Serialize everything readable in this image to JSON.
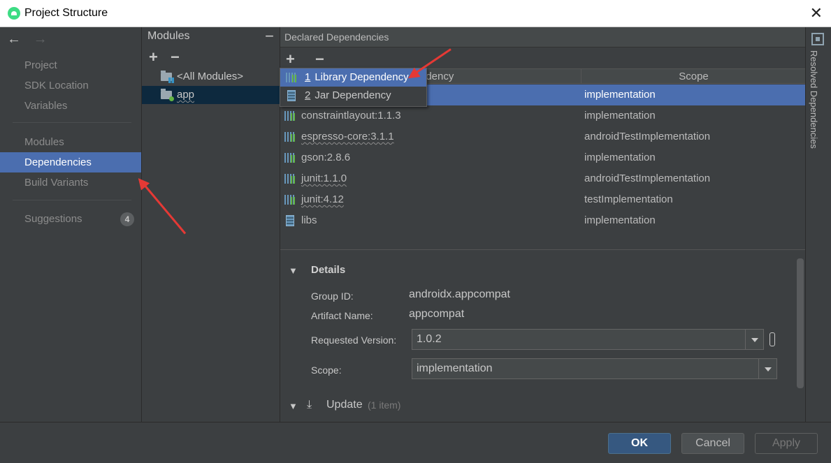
{
  "window": {
    "title": "Project Structure"
  },
  "nav": {
    "back_icon": "arrow-left-icon",
    "forward_icon": "arrow-right-icon",
    "items": [
      {
        "label": "Project"
      },
      {
        "label": "SDK Location"
      },
      {
        "label": "Variables"
      },
      {
        "label": "Modules"
      },
      {
        "label": "Dependencies",
        "selected": true
      },
      {
        "label": "Build Variants"
      },
      {
        "label": "Suggestions",
        "badge": "4"
      }
    ]
  },
  "modules": {
    "header": "Modules",
    "add": "+",
    "remove": "−",
    "collapse": "−",
    "items": [
      {
        "label": "<All Modules>"
      },
      {
        "label": "app",
        "selected": true
      }
    ]
  },
  "dependencies": {
    "header": "Declared Dependencies",
    "add": "+",
    "remove": "−",
    "columns": {
      "dependency": "ndency",
      "scope": "Scope"
    },
    "rows": [
      {
        "name": "",
        "scope": "implementation",
        "icon": "library-icon",
        "selected": true
      },
      {
        "name": "constraintlayout:1.1.3",
        "scope": "implementation",
        "icon": "library-icon"
      },
      {
        "name": "espresso-core:3.1.1",
        "scope": "androidTestImplementation",
        "icon": "library-icon"
      },
      {
        "name": "gson:2.8.6",
        "scope": "implementation",
        "icon": "library-icon"
      },
      {
        "name": "junit:1.1.0",
        "scope": "androidTestImplementation",
        "icon": "library-icon"
      },
      {
        "name": "junit:4.12",
        "scope": "testImplementation",
        "icon": "library-icon"
      },
      {
        "name": "libs",
        "scope": "implementation",
        "icon": "jar-icon"
      }
    ]
  },
  "popup": {
    "items": [
      {
        "mnemonic": "1",
        "label": "Library Dependency",
        "selected": true
      },
      {
        "mnemonic": "2",
        "label": "Jar Dependency"
      }
    ]
  },
  "details": {
    "title": "Details",
    "group_id_label": "Group ID:",
    "group_id": "androidx.appcompat",
    "artifact_label": "Artifact Name:",
    "artifact": "appcompat",
    "version_label": "Requested Version:",
    "version": "1.0.2",
    "scope_label": "Scope:",
    "scope": "implementation",
    "update_label": "Update",
    "update_count": "(1 item)"
  },
  "right_strip": {
    "label": "Resolved Dependencies"
  },
  "buttons": {
    "ok": "OK",
    "cancel": "Cancel",
    "apply": "Apply"
  },
  "colors": {
    "accent": "#4b6eaf",
    "annotation": "#e53935",
    "primary_button": "#365880"
  }
}
